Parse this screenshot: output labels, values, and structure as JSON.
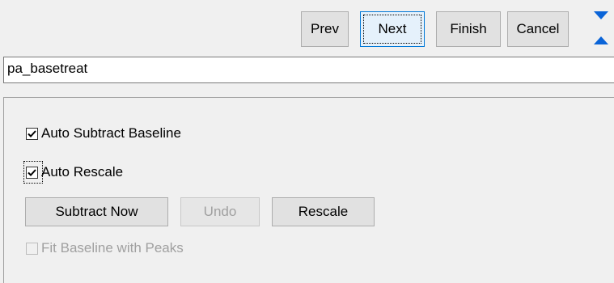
{
  "toolbar": {
    "prev_label": "Prev",
    "next_label": "Next",
    "finish_label": "Finish",
    "cancel_label": "Cancel"
  },
  "title_field": {
    "value": "pa_basetreat"
  },
  "options": {
    "auto_subtract_baseline": {
      "label": "Auto Subtract Baseline",
      "checked": true
    },
    "auto_rescale": {
      "label": "Auto Rescale",
      "checked": true
    },
    "fit_baseline_with_peaks": {
      "label": "Fit Baseline with Peaks",
      "checked": false,
      "enabled": false
    }
  },
  "actions": {
    "subtract_now_label": "Subtract Now",
    "undo_label": "Undo",
    "rescale_label": "Rescale"
  },
  "colors": {
    "accent": "#0078d7",
    "arrow": "#0a64d8"
  },
  "icons": {
    "scroll_down": "triangle-down-icon",
    "scroll_up": "triangle-up-icon"
  }
}
